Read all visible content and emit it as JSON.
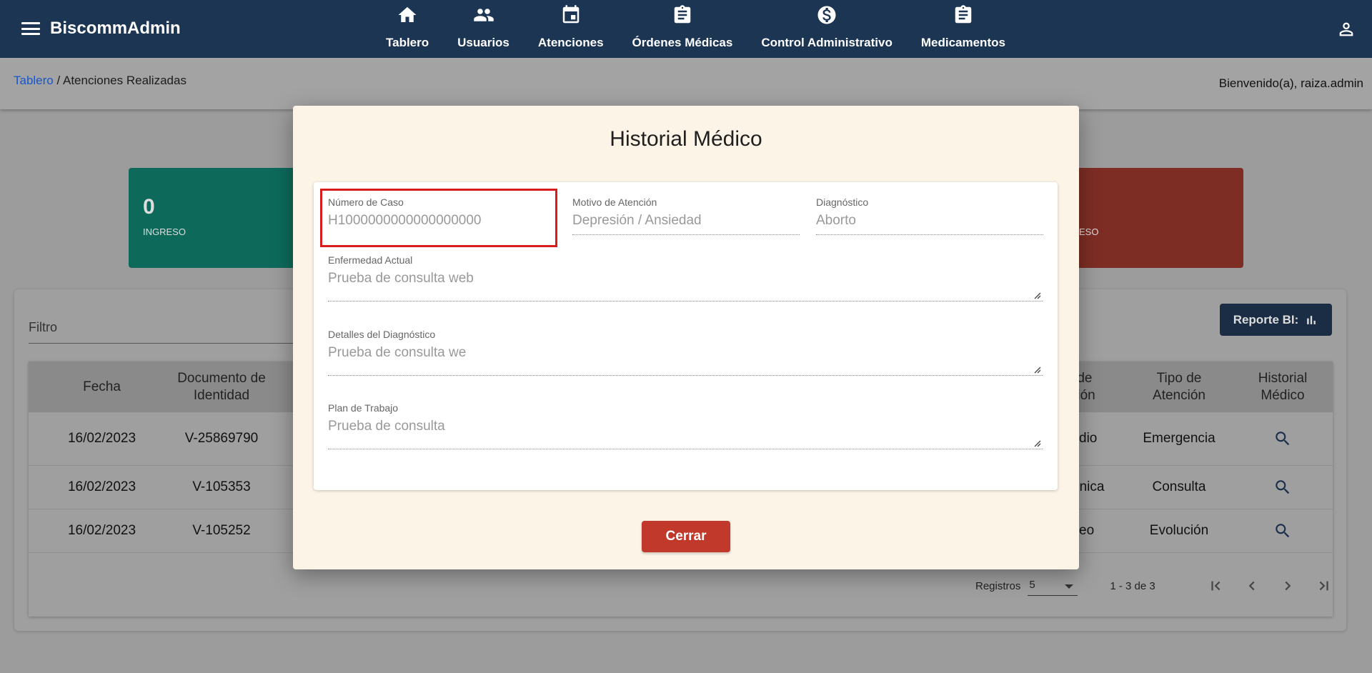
{
  "app": {
    "name": "BiscommAdmin"
  },
  "nav": [
    {
      "label": "Tablero",
      "icon": "home-icon"
    },
    {
      "label": "Usuarios",
      "icon": "users-icon"
    },
    {
      "label": "Atenciones",
      "icon": "calendar-icon"
    },
    {
      "label": "Órdenes Médicas",
      "icon": "clipboard-icon"
    },
    {
      "label": "Control Administrativo",
      "icon": "dollar-icon"
    },
    {
      "label": "Medicamentos",
      "icon": "clipboard-icon"
    }
  ],
  "breadcrumb": {
    "root": "Tablero",
    "separator": " / ",
    "current": "Atenciones Realizadas"
  },
  "welcome": "Bienvenido(a), raiza.admin",
  "cards": [
    {
      "value": "0",
      "caption": "INGRESO"
    },
    {
      "value": "",
      "caption": "ESO"
    }
  ],
  "filter": {
    "placeholder": "Filtro"
  },
  "report_button": {
    "label": "Reporte BI:",
    "icon": "bar-chart-icon"
  },
  "table": {
    "headers": [
      "Fecha",
      "Documento de Identidad",
      "o de exión",
      "Tipo de Atención",
      "Historial Médico"
    ],
    "rows": [
      {
        "fecha": "16/02/2023",
        "documento": "V-25869790",
        "conexion": "dio",
        "tipo": "Emergencia"
      },
      {
        "fecha": "16/02/2023",
        "documento": "V-105353",
        "conexion": "ónica",
        "tipo": "Consulta"
      },
      {
        "fecha": "16/02/2023",
        "documento": "V-105252",
        "conexion": "eo",
        "tipo": "Evolución"
      }
    ]
  },
  "paginator": {
    "label": "Registros",
    "page_size": "5",
    "range": "1 - 3 de 3"
  },
  "modal": {
    "title": "Historial Médico",
    "fields": {
      "numero_caso": {
        "label": "Número de Caso",
        "value": "H1000000000000000000"
      },
      "motivo": {
        "label": "Motivo de Atención",
        "value": "Depresión / Ansiedad"
      },
      "diagnostico": {
        "label": "Diagnóstico",
        "value": "Aborto"
      },
      "enfermedad": {
        "label": "Enfermedad Actual",
        "value": "Prueba de consulta web"
      },
      "detalles": {
        "label": "Detalles del Diagnóstico",
        "value": "Prueba de consulta we"
      },
      "plan": {
        "label": "Plan de Trabajo",
        "value": "Prueba de consulta"
      }
    },
    "close_label": "Cerrar"
  },
  "colors": {
    "topbar": "#1c3553",
    "modal_bg": "#fcf4e7",
    "close_button": "#c0392b",
    "highlight": "#d81b1b",
    "link": "#1b56c4"
  }
}
